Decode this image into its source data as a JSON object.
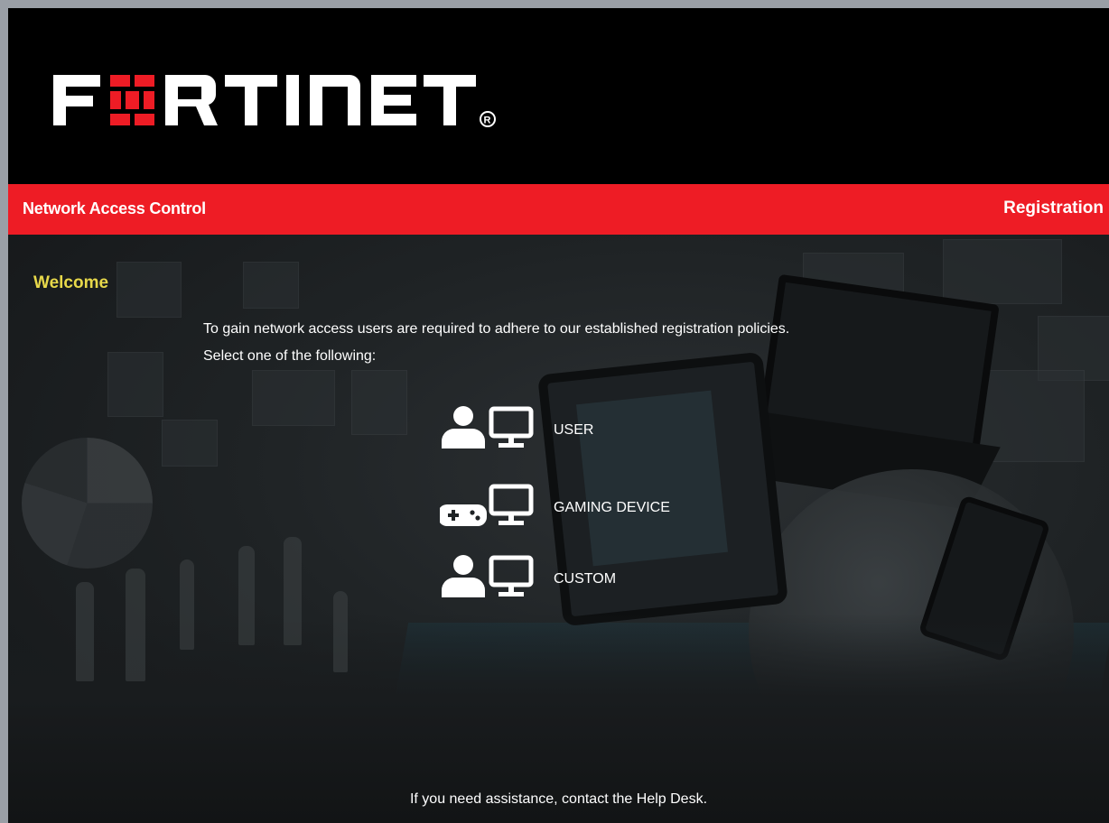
{
  "header": {
    "logo_text": "FORTINET",
    "logo_mark": "®"
  },
  "redbar": {
    "title": "Network Access Control",
    "right_title": "Registration"
  },
  "content": {
    "welcome": "Welcome",
    "intro_line1": "To gain network access users are required to adhere to our established registration policies.",
    "intro_line2": "Select one of the following:",
    "options": [
      {
        "label": "USER",
        "icon": "user-icon",
        "device_icon": "monitor-icon"
      },
      {
        "label": "GAMING DEVICE",
        "icon": "gamepad-icon",
        "device_icon": "monitor-icon"
      },
      {
        "label": "CUSTOM",
        "icon": "user-icon",
        "device_icon": "monitor-icon"
      }
    ],
    "help_text": "If you need assistance, contact the Help Desk."
  },
  "colors": {
    "brand_red": "#ee1c25",
    "welcome_yellow": "#e7d84a",
    "header_black": "#000000"
  }
}
